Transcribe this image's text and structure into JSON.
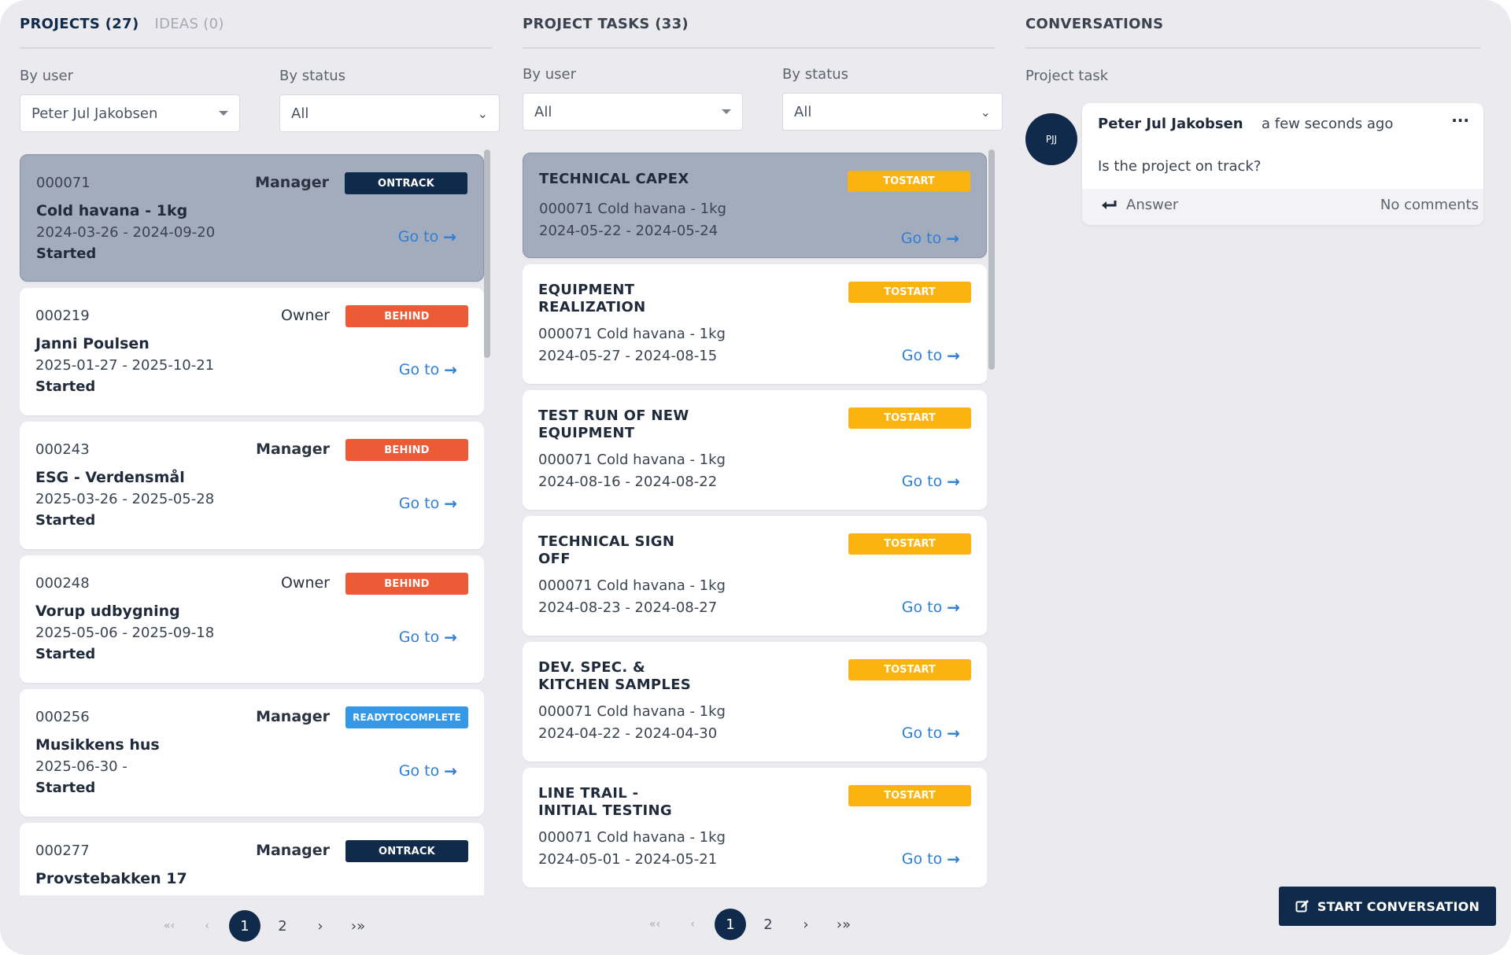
{
  "projects_panel": {
    "tab_projects": "PROJECTS (27)",
    "tab_ideas": "IDEAS (0)",
    "filter_user_label": "By user",
    "filter_user_value": "Peter Jul Jakobsen",
    "filter_status_label": "By status",
    "filter_status_value": "All",
    "goto_label": "Go to",
    "items": [
      {
        "id": "000071",
        "role": "Manager",
        "badge": "ONTRACK",
        "name": "Cold havana - 1kg",
        "dates": "2024-03-26 - 2024-09-20",
        "status": "Started"
      },
      {
        "id": "000219",
        "role": "Owner",
        "badge": "BEHIND",
        "name": "Janni Poulsen",
        "dates": "2025-01-27 - 2025-10-21",
        "status": "Started"
      },
      {
        "id": "000243",
        "role": "Manager",
        "badge": "BEHIND",
        "name": "ESG - Verdensmål",
        "dates": "2025-03-26 - 2025-05-28",
        "status": "Started"
      },
      {
        "id": "000248",
        "role": "Owner",
        "badge": "BEHIND",
        "name": "Vorup udbygning",
        "dates": "2025-05-06 - 2025-09-18",
        "status": "Started"
      },
      {
        "id": "000256",
        "role": "Manager",
        "badge": "READYTOCOMPLETE",
        "name": "Musikkens hus",
        "dates": "2025-06-30 -",
        "status": "Started"
      },
      {
        "id": "000277",
        "role": "Manager",
        "badge": "ONTRACK",
        "name": "Provstebakken 17",
        "dates": "",
        "status": ""
      }
    ],
    "pager": {
      "first": "«‹",
      "prev": "‹",
      "current": "1",
      "next_page": "2",
      "next": "›",
      "last": "›»"
    }
  },
  "tasks_panel": {
    "tab_tasks": "PROJECT TASKS (33)",
    "filter_user_label": "By user",
    "filter_user_value": "All",
    "filter_status_label": "By status",
    "filter_status_value": "All",
    "goto_label": "Go to",
    "items": [
      {
        "name": "TECHNICAL CAPEX",
        "badge": "TOSTART",
        "project": "000071 Cold havana - 1kg",
        "dates": "2024-05-22 - 2024-05-24"
      },
      {
        "name": "EQUIPMENT REALIZATION",
        "badge": "TOSTART",
        "project": "000071 Cold havana - 1kg",
        "dates": "2024-05-27 - 2024-08-15"
      },
      {
        "name": "TEST RUN OF NEW EQUIPMENT",
        "badge": "TOSTART",
        "project": "000071 Cold havana - 1kg",
        "dates": "2024-08-16 - 2024-08-22"
      },
      {
        "name": "TECHNICAL SIGN OFF",
        "badge": "TOSTART",
        "project": "000071 Cold havana - 1kg",
        "dates": "2024-08-23 - 2024-08-27"
      },
      {
        "name": "DEV. SPEC. & KITCHEN SAMPLES",
        "badge": "TOSTART",
        "project": "000071 Cold havana - 1kg",
        "dates": "2024-04-22 - 2024-04-30"
      },
      {
        "name": "LINE TRAIL - INITIAL TESTING",
        "badge": "TOSTART",
        "project": "000071 Cold havana - 1kg",
        "dates": "2024-05-01 - 2024-05-21"
      }
    ],
    "pager": {
      "first": "«‹",
      "prev": "‹",
      "current": "1",
      "next_page": "2",
      "next": "›",
      "last": "›»"
    }
  },
  "conversations_panel": {
    "title": "CONVERSATIONS",
    "context_label": "Project task",
    "message": {
      "avatar_initials": "PJJ",
      "author": "Peter Jul Jakobsen",
      "time": "a few seconds ago",
      "menu": "···",
      "text": "Is the project on track?",
      "answer_label": "Answer",
      "comments": "No comments"
    },
    "start_button": "START CONVERSATION"
  },
  "colors": {
    "ontrack": "#0f2a4a",
    "behind": "#ec5a36",
    "readytocomplete": "#3498e8",
    "tostart": "#fbb30f",
    "link": "#2f7fd6",
    "primary": "#0f2a4a"
  }
}
